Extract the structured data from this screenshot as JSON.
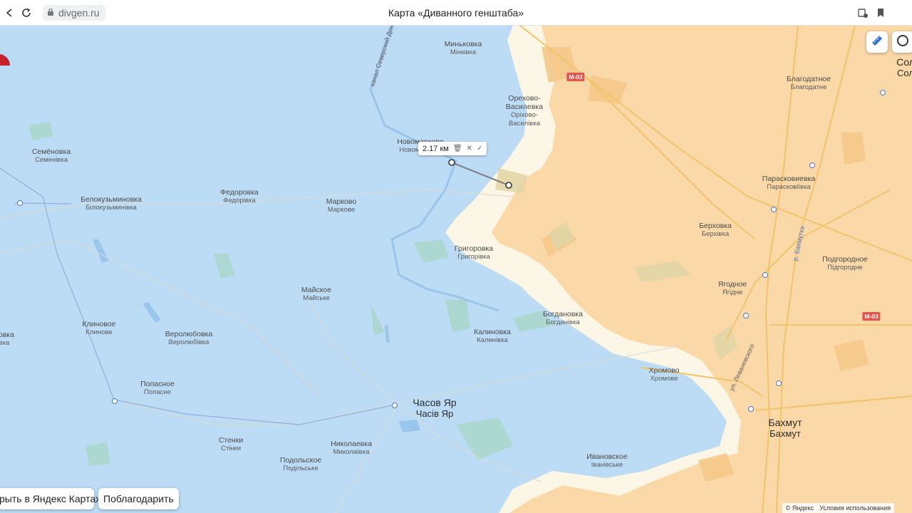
{
  "browser": {
    "url": "divgen.ru",
    "title": "Карта «Диванного генштаба»"
  },
  "map": {
    "colors": {
      "friendly_area": "#bcdcf6",
      "occupied_area": "#fbd8a8",
      "contested_area": "#fbf6e6"
    },
    "measure": {
      "distance": "2.17 км",
      "delete_icon": "trash-icon",
      "close_icon": "close-icon",
      "confirm_icon": "check-icon"
    },
    "places": [
      {
        "id": "minkovka",
        "ru": "Миньковка",
        "ua": "Мінківка"
      },
      {
        "id": "orekhovo",
        "ru": "Орехово-Василевка",
        "ua": "Оріхово-Василівка"
      },
      {
        "id": "novomarkovo",
        "ru": "Новомарково",
        "ua": "Новомаркове"
      },
      {
        "id": "semenovka",
        "ru": "Семёновка",
        "ua": "Семенівка"
      },
      {
        "id": "belokuzm",
        "ru": "Белокузьминовка",
        "ua": "Білокузьминівка"
      },
      {
        "id": "fedorovka",
        "ru": "Федоровка",
        "ua": "Федорівка"
      },
      {
        "id": "markovo",
        "ru": "Марково",
        "ua": "Маркове"
      },
      {
        "id": "grigorovka",
        "ru": "Григоровка",
        "ua": "Григорівка"
      },
      {
        "id": "mayskoe",
        "ru": "Майское",
        "ua": "Майське"
      },
      {
        "id": "klinovoe",
        "ru": "Клиновое",
        "ua": "Клинове"
      },
      {
        "id": "verolyubovka",
        "ru": "Веролюбовка",
        "ua": "Веролюбівка"
      },
      {
        "id": "bogdanovka",
        "ru": "Богдановка",
        "ua": "Богданівка"
      },
      {
        "id": "kalinovka",
        "ru": "Калиновка",
        "ua": "Калинівка"
      },
      {
        "id": "popasnoe",
        "ru": "Попасное",
        "ua": "Попасне"
      },
      {
        "id": "chasovyar",
        "ru": "Часов Яр",
        "ua": "Часів Яр"
      },
      {
        "id": "stenki",
        "ru": "Стенки",
        "ua": "Стінки"
      },
      {
        "id": "nikolaevka",
        "ru": "Николаевка",
        "ua": "Миколаївка"
      },
      {
        "id": "podolskoe",
        "ru": "Подольское",
        "ua": "Подільське"
      },
      {
        "id": "ivanovskoe",
        "ru": "Ивановское",
        "ua": "Іванівське"
      },
      {
        "id": "khromovo",
        "ru": "Хромово",
        "ua": "Хромове"
      },
      {
        "id": "bakhmut",
        "ru": "Бахмут",
        "ua": "Бахмут"
      },
      {
        "id": "blagodatnoe",
        "ru": "Благодатное",
        "ua": "Благодатне"
      },
      {
        "id": "paraskovievka",
        "ru": "Парасковиевка",
        "ua": "Парасковіївка"
      },
      {
        "id": "berkhovka",
        "ru": "Берховка",
        "ua": "Берхівка"
      },
      {
        "id": "podgorodnoe",
        "ru": "Подгородное",
        "ua": "Підгородне"
      },
      {
        "id": "yagodnoe",
        "ru": "Ягодное",
        "ua": "Ягідне"
      },
      {
        "id": "sol",
        "ru": "Сол",
        "ua": "Сол"
      },
      {
        "id": "edge_left",
        "ru": "новка",
        "ua": "вка"
      }
    ],
    "road_labels": {
      "m03_a": "М-03",
      "m03_b": "М-03",
      "canal": "канал Северский Донец",
      "bakhmutka": "р. Бахмутка",
      "levanevskogo": "ул. Леваневского"
    },
    "buttons": {
      "open_yandex": "рыть в Яндекс Картах",
      "thank": "Поблагодарить"
    },
    "copyright": {
      "yandex": "© Яндекс",
      "terms": "Условия использования"
    }
  }
}
